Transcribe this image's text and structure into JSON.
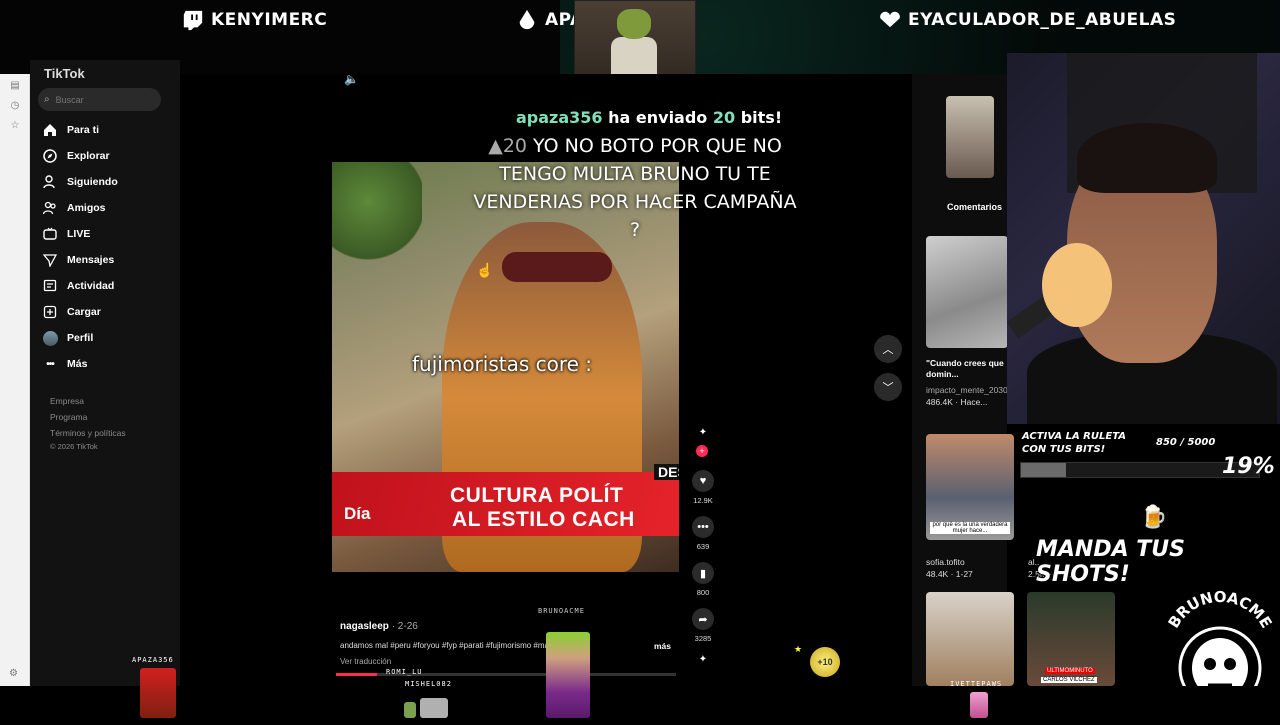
{
  "banner": {
    "streamers": [
      {
        "name": "KENYIMERC",
        "icon": "twitch-icon"
      },
      {
        "name": "APA",
        "icon": "drop-icon"
      },
      {
        "name": "EYACULADOR_DE_ABUELAS",
        "icon": "heart-icon"
      }
    ]
  },
  "tiktok": {
    "logo": "TikTok",
    "search_placeholder": "Buscar",
    "nav": [
      {
        "label": "Para ti",
        "icon": "home-icon"
      },
      {
        "label": "Explorar",
        "icon": "compass-icon"
      },
      {
        "label": "Siguiendo",
        "icon": "following-icon"
      },
      {
        "label": "Amigos",
        "icon": "friends-icon"
      },
      {
        "label": "LIVE",
        "icon": "live-icon"
      },
      {
        "label": "Mensajes",
        "icon": "messages-icon"
      },
      {
        "label": "Actividad",
        "icon": "activity-icon"
      },
      {
        "label": "Cargar",
        "icon": "upload-icon"
      },
      {
        "label": "Perfil",
        "icon": "profile-avatar"
      },
      {
        "label": "Más",
        "icon": "more-icon"
      }
    ],
    "footer": [
      "Empresa",
      "Programa",
      "Términos y políticas",
      "© 2026 TikTok"
    ]
  },
  "video": {
    "caption": "fujimoristas core :",
    "lower_third_line1": "CULTURA POLÍT",
    "lower_third_line2": "AL ESTILO CACH",
    "lower_third_tag": "Día",
    "lower_third_corner": "DES",
    "author": "nagasleep",
    "date": "· 2-26",
    "description": "andamos mal #peru #foryou #fyp #parati #fujimorismo #mamas",
    "more": "más",
    "translate": "Ver traducción",
    "progress": 0.12,
    "likes": "12.9K",
    "comments": "639",
    "saves": "800",
    "shares": "3285"
  },
  "alert": {
    "user": "apaza356",
    "middle": "ha enviado",
    "amount": "20",
    "suffix": "bits!",
    "bits_badge": "20",
    "message": "YO NO BOTO POR QUE NO TENGO MULTA BRUNO TU TE VENDERIAS POR HAcER CAMPAÑA ?"
  },
  "right_panel": {
    "comments_label": "Comentarios",
    "item1_title": "\"Cuando crees que domin...",
    "item1_user": "impacto_mente_2030",
    "item1_stats": "486.4K · Hace...",
    "item2_overlay": "por qué es la una verdadera mujer hace...",
    "item2_user": "sofia.tofito",
    "item2_stats": "48.4K · 1-27",
    "item3_user": "al...",
    "item3_stats": "2.5M · 3-12",
    "item4_overlay1": "ULTIMOMINUTO",
    "item4_overlay2": "CARLOS VILCHEZ"
  },
  "overlay": {
    "ruleta_text": "ACTIVA LA RULETA CON TUS BITS!",
    "bits_progress": "850 / 5000",
    "percent": "19%",
    "fill": 0.19,
    "shots_text": "MANDA TUS SHOTS!",
    "brand": "BRUNOACME",
    "coin_label": "+10"
  },
  "chat_sprites": {
    "apaza": "APAZA356",
    "brunoacme": "BRUNOACME",
    "romi": "ROMI_LU",
    "mishel": "MISHEL082",
    "ivette": "IVETTEPAWS"
  }
}
